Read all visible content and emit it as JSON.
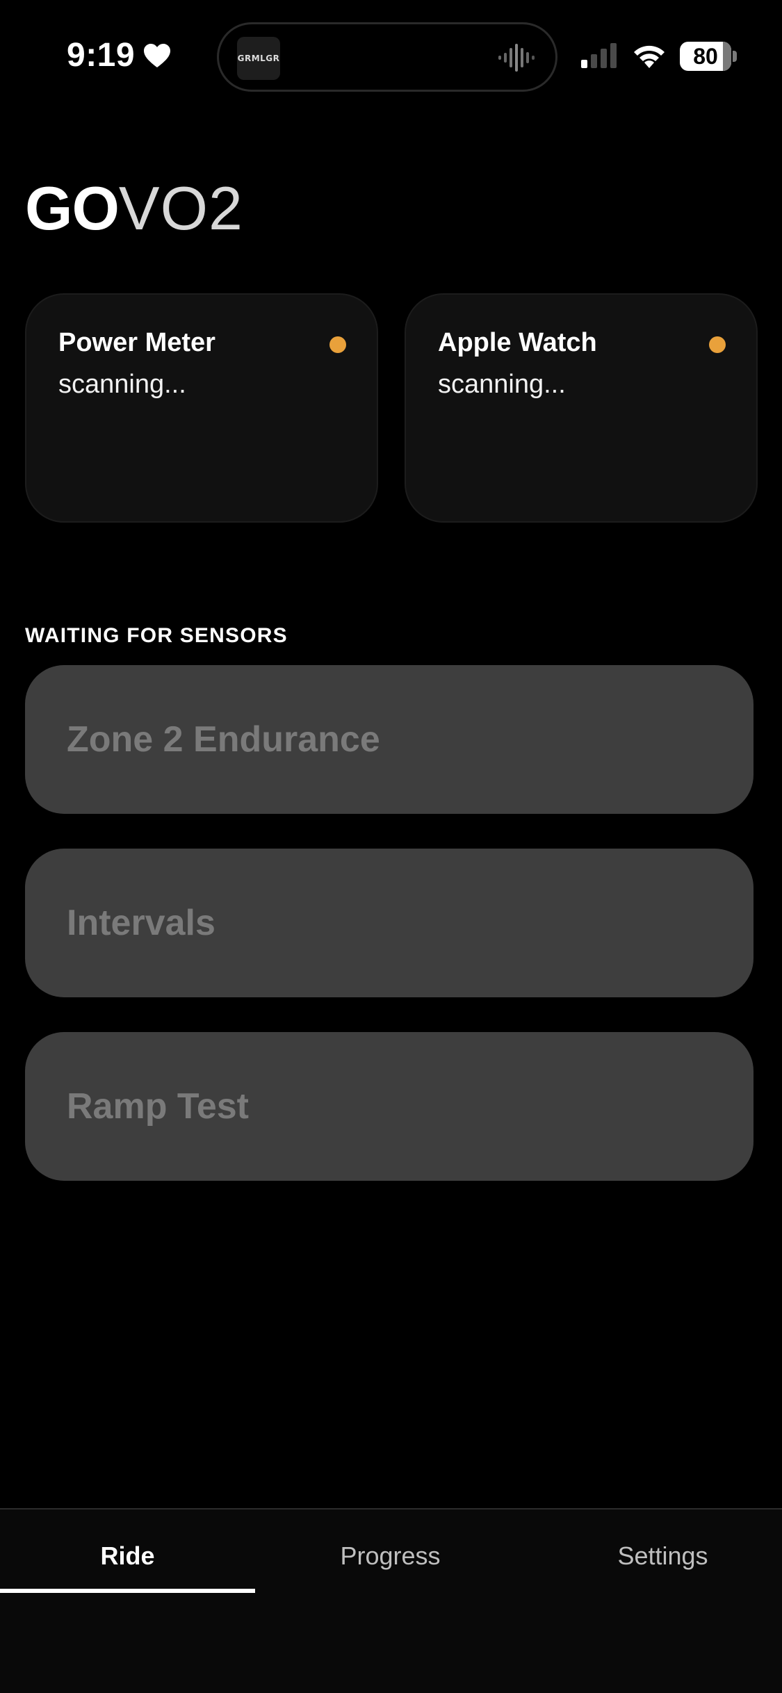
{
  "status_bar": {
    "time": "9:19",
    "battery_level": "80",
    "island_art_text": "GRMLGR"
  },
  "logo": {
    "bold": "GO",
    "light": "VO2"
  },
  "sensors": [
    {
      "name": "Power Meter",
      "status": "scanning...",
      "dot_color": "#e9a13b"
    },
    {
      "name": "Apple Watch",
      "status": "scanning...",
      "dot_color": "#e9a13b"
    }
  ],
  "section_header": "WAITING FOR SENSORS",
  "workouts": [
    {
      "label": "Zone 2 Endurance"
    },
    {
      "label": "Intervals"
    },
    {
      "label": "Ramp Test"
    }
  ],
  "tabs": [
    {
      "label": "Ride",
      "active": true
    },
    {
      "label": "Progress",
      "active": false
    },
    {
      "label": "Settings",
      "active": false
    }
  ]
}
